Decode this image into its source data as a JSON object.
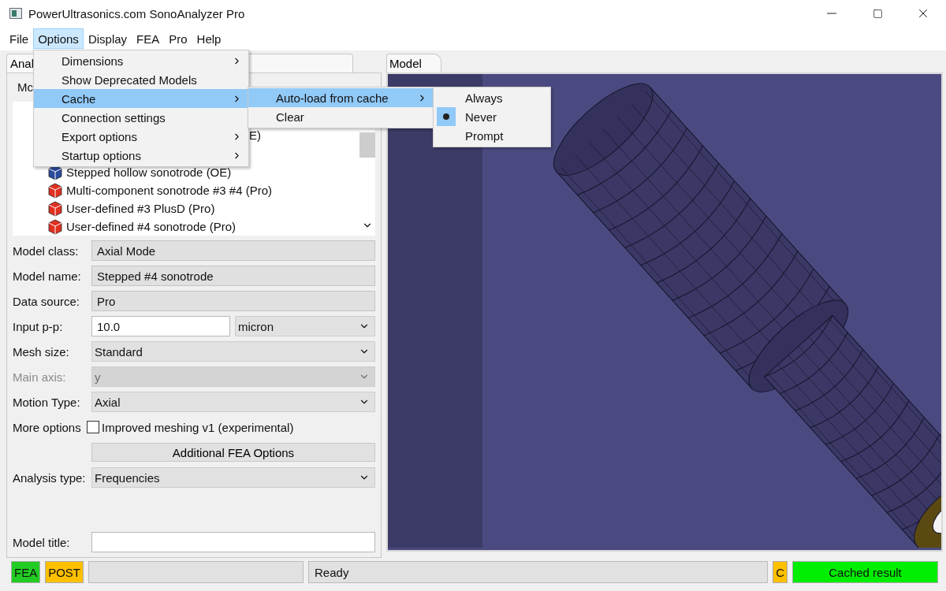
{
  "window": {
    "title": "PowerUltrasonics.com SonoAnalyzer Pro"
  },
  "menubar": [
    {
      "label": "File",
      "selected": false
    },
    {
      "label": "Options",
      "selected": true
    },
    {
      "label": "Display",
      "selected": false
    },
    {
      "label": "FEA",
      "selected": false
    },
    {
      "label": "Pro",
      "selected": false
    },
    {
      "label": "Help",
      "selected": false
    }
  ],
  "options_menu": [
    {
      "label": "Dimensions",
      "submenu": true,
      "selected": false
    },
    {
      "label": "Show Deprecated Models",
      "submenu": false,
      "selected": false
    },
    {
      "label": "Cache",
      "submenu": true,
      "selected": true
    },
    {
      "label": "Connection settings",
      "submenu": false,
      "selected": false
    },
    {
      "label": "Export options",
      "submenu": true,
      "selected": false
    },
    {
      "label": "Startup options",
      "submenu": true,
      "selected": false
    }
  ],
  "cache_submenu": [
    {
      "label": "Auto-load from cache",
      "submenu": true,
      "selected": true
    },
    {
      "label": "Clear",
      "submenu": false,
      "selected": false
    }
  ],
  "autoload_submenu": [
    {
      "label": "Always",
      "selected": false
    },
    {
      "label": "Never",
      "selected": true
    },
    {
      "label": "Prompt",
      "selected": false
    }
  ],
  "left_panel": {
    "tab": "Anal",
    "models_label": "Mc",
    "model_list": [
      {
        "label": "E)",
        "kind": "partial"
      },
      {
        "label": "Stepped hollow sonotrode (OE)",
        "kind": "oe"
      },
      {
        "label": "Multi-component sonotrode #3 #4 (Pro)",
        "kind": "pro"
      },
      {
        "label": "User-defined #3 PlusD (Pro)",
        "kind": "pro"
      },
      {
        "label": "User-defined #4 sonotrode (Pro)",
        "kind": "pro"
      }
    ],
    "form": [
      {
        "kind": "readonly",
        "label": "Model class:",
        "value": "Axial Mode"
      },
      {
        "kind": "readonly",
        "label": "Model name:",
        "value": "Stepped #4 sonotrode"
      },
      {
        "kind": "readonly",
        "label": "Data source:",
        "value": "Pro"
      },
      {
        "kind": "input_unit",
        "label": "Input p-p:",
        "value": "10.0",
        "unit": "micron"
      },
      {
        "kind": "select",
        "label": "Mesh size:",
        "value": "Standard",
        "disabled": false
      },
      {
        "kind": "select",
        "label": "Main axis:",
        "value": "y",
        "disabled": true
      },
      {
        "kind": "select",
        "label": "Motion Type:",
        "value": "Axial",
        "disabled": false
      },
      {
        "kind": "checkbox",
        "label": "More options",
        "option": "Improved meshing v1 (experimental)",
        "checked": false
      },
      {
        "kind": "button",
        "label": "Additional FEA Options"
      },
      {
        "kind": "select",
        "label": "Analysis type:",
        "value": "Frequencies",
        "disabled": false
      },
      {
        "kind": "text_input",
        "label": "Model title:"
      }
    ]
  },
  "model_panel": {
    "tab": "Model"
  },
  "status_bar": [
    {
      "kind": "indicator",
      "label": "FEA",
      "color": "#22cc22"
    },
    {
      "kind": "indicator",
      "label": "POST",
      "color": "#ffc000"
    },
    {
      "kind": "field"
    },
    {
      "kind": "field",
      "label": "Ready"
    },
    {
      "kind": "indicator",
      "label": "C",
      "color": "#ffc000"
    },
    {
      "kind": "indicator",
      "label": "Cached result",
      "color": "#00ee00"
    }
  ]
}
